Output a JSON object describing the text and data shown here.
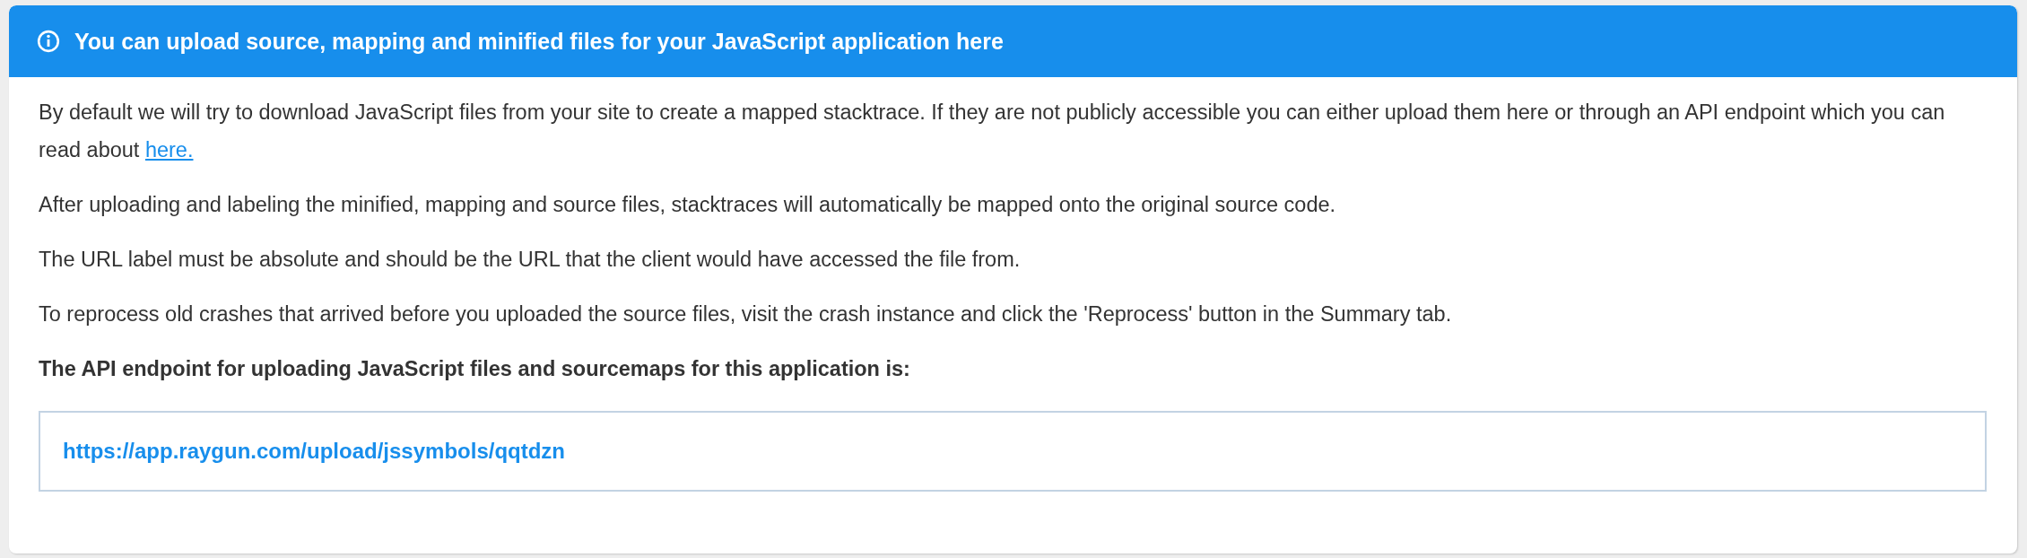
{
  "panel": {
    "title": "You can upload source, mapping and minified files for your JavaScript application here",
    "paragraphs": [
      {
        "text": "By default we will try to download JavaScript files from your site to create a mapped stacktrace. If they are not publicly accessible you can either upload them here or through an API endpoint which you can read about ",
        "link": "here."
      },
      {
        "text": "After uploading and labeling the minified, mapping and source files, stacktraces will automatically be mapped onto the original source code."
      },
      {
        "text": "The URL label must be absolute and should be the URL that the client would have accessed the file from."
      },
      {
        "text": "To reprocess old crashes that arrived before you uploaded the source files, visit the crash instance and click the 'Reprocess' button in the Summary tab."
      }
    ],
    "endpoint_label": "The API endpoint for uploading JavaScript files and sourcemaps for this application is:",
    "endpoint_url": "https://app.raygun.com/upload/jssymbols/qqtdzn"
  }
}
